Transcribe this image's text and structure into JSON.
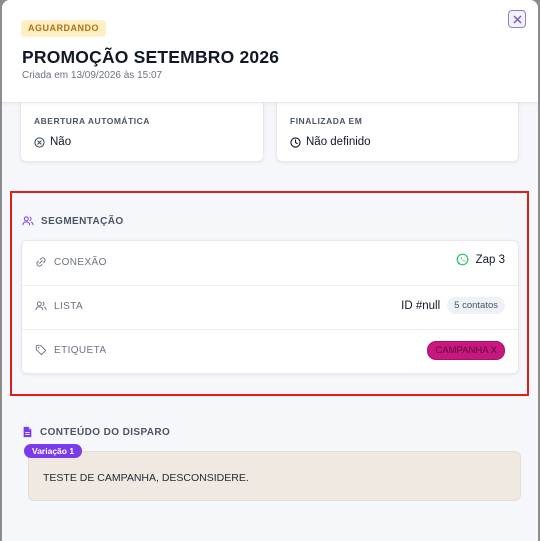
{
  "colors": {
    "accent": "#7c3aed",
    "status_bg": "#fdf0c7",
    "status_text": "#b8700c",
    "tag": "#c8177f",
    "highlight": "#e11d1d",
    "whatsapp": "#22c55e"
  },
  "header": {
    "status_badge": "AGUARDANDO",
    "title": "PROMOÇÃO SETEMBRO 2026",
    "subtitle": "Criada em 13/09/2026 às 15:07",
    "close_icon": "close-icon"
  },
  "info_cards": [
    {
      "label": "ABERTURA AUTOMÁTICA",
      "value": "Não",
      "icon": "circle-x-icon"
    },
    {
      "label": "FINALIZADA EM",
      "value": "Não definido",
      "icon": "clock-icon"
    }
  ],
  "segmentation": {
    "title": "SEGMENTAÇÃO",
    "icon": "users-icon",
    "rows": {
      "connection": {
        "label": "CONEXÃO",
        "icon": "link-icon",
        "value": "Zap 3",
        "value_icon": "whatsapp-icon"
      },
      "list": {
        "label": "LISTA",
        "icon": "users-icon",
        "value": "ID #null",
        "count": "5 contatos"
      },
      "tag": {
        "label": "ETIQUETA",
        "icon": "tag-icon",
        "value": "CAMPANHA X"
      }
    }
  },
  "content": {
    "title": "CONTEÚDO DO DISPARO",
    "icon": "document-icon",
    "variant": "Variação 1",
    "text": "TESTE DE CAMPANHA, DESCONSIDERE."
  }
}
